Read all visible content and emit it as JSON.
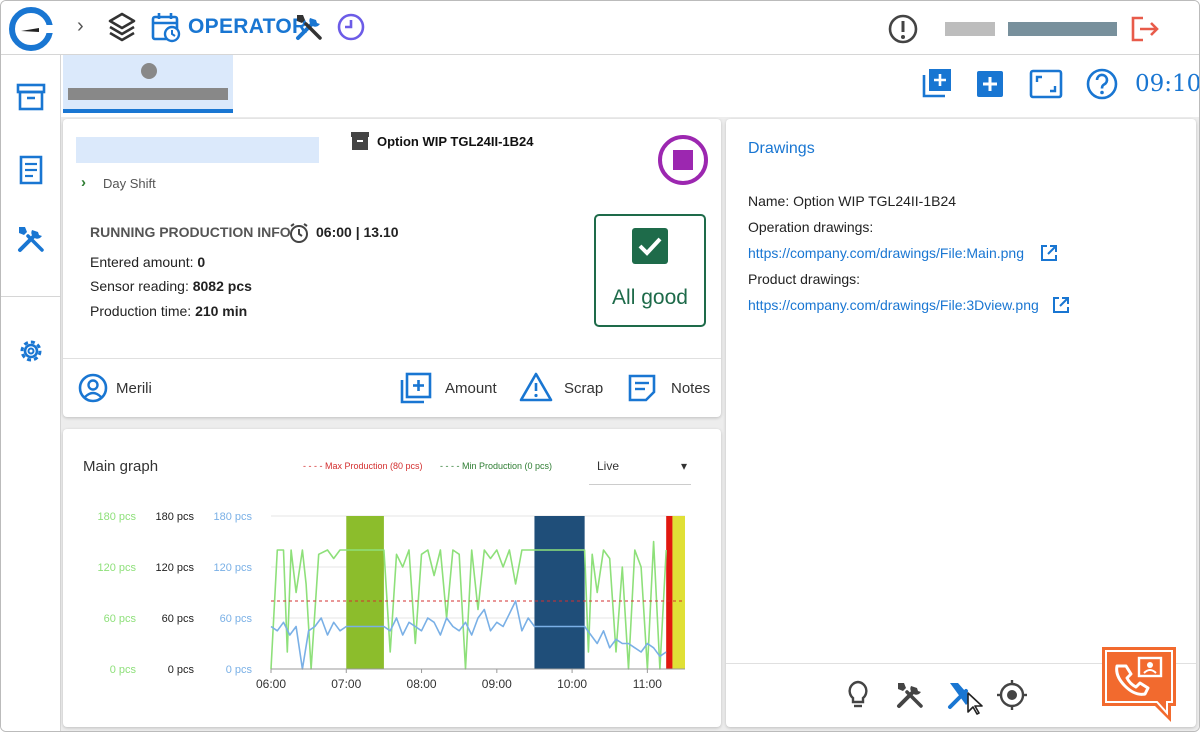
{
  "header": {
    "section_label": "OPERATOR",
    "breadcrumb_separator": "›"
  },
  "tabs": {
    "clock": "09:10"
  },
  "order": {
    "title": "Option WIP TGL24II-1B24",
    "shift": "Day Shift",
    "running_info_title": "RUNNING PRODUCTION INFO",
    "time_range": "06:00 | 13.10",
    "entered_amount_label": "Entered amount:",
    "entered_amount_value": "0",
    "sensor_reading_label": "Sensor reading:",
    "sensor_reading_value": "8082 pcs",
    "production_time_label": "Production time:",
    "production_time_value": "210 min",
    "status_text": "All good",
    "operator_name": "Merili",
    "amount_label": "Amount",
    "scrap_label": "Scrap",
    "notes_label": "Notes"
  },
  "graph": {
    "title": "Main graph",
    "legend_max": "Max Production (80 pcs)",
    "legend_min": "Min Production (0 pcs)",
    "select_value": "Live"
  },
  "chart_data": {
    "type": "line",
    "title": "Main graph",
    "x_ticks": [
      "06:00",
      "07:00",
      "08:00",
      "09:00",
      "10:00",
      "11:00"
    ],
    "xlim": [
      "06:00",
      "11:30"
    ],
    "ylim": [
      0,
      180
    ],
    "y_axes": [
      {
        "ticks": [
          "180 pcs",
          "120 pcs",
          "60 pcs",
          "0 pcs"
        ],
        "color": "#8ee07a"
      },
      {
        "ticks": [
          "180 pcs",
          "120 pcs",
          "60 pcs",
          "0 pcs"
        ],
        "color": "#222222"
      },
      {
        "ticks": [
          "180 pcs",
          "120 pcs",
          "60 pcs",
          "0 pcs"
        ],
        "color": "#7ab0e6"
      }
    ],
    "thresholds": [
      {
        "name": "Max Production (80 pcs)",
        "value": 80,
        "color": "#d32f2f"
      },
      {
        "name": "Min Production (0 pcs)",
        "value": 0,
        "color": "#2e7d32"
      }
    ],
    "bands": [
      {
        "start": "07:00",
        "end": "07:30",
        "color": "#8cbd2c"
      },
      {
        "start": "09:30",
        "end": "10:10",
        "color": "#1f4e79"
      },
      {
        "start": "11:15",
        "end": "11:20",
        "color": "#e1180f"
      },
      {
        "start": "11:20",
        "end": "11:30",
        "color": "#e0e036"
      }
    ],
    "series": [
      {
        "color": "#8ee07a",
        "x": [
          "06:00",
          "06:05",
          "06:10",
          "06:13",
          "06:16",
          "06:20",
          "06:25",
          "06:28",
          "06:32",
          "06:38",
          "06:45",
          "06:50",
          "06:55",
          "07:00",
          "07:30",
          "07:35",
          "07:40",
          "07:45",
          "07:50",
          "07:55",
          "08:00",
          "08:05",
          "08:10",
          "08:15",
          "08:20",
          "08:25",
          "08:30",
          "08:35",
          "08:40",
          "08:45",
          "08:50",
          "08:55",
          "09:00",
          "09:05",
          "09:10",
          "09:15",
          "09:20",
          "09:25",
          "09:30",
          "10:10",
          "10:13",
          "10:16",
          "10:20",
          "10:25",
          "10:30",
          "10:35",
          "10:40",
          "10:45",
          "10:50",
          "10:55",
          "11:00",
          "11:05",
          "11:10",
          "11:15"
        ],
        "y": [
          0,
          140,
          140,
          20,
          140,
          90,
          140,
          100,
          0,
          135,
          140,
          130,
          140,
          140,
          140,
          20,
          135,
          120,
          140,
          30,
          135,
          140,
          110,
          140,
          60,
          140,
          135,
          0,
          140,
          70,
          140,
          130,
          140,
          120,
          140,
          100,
          140,
          140,
          140,
          140,
          20,
          135,
          90,
          140,
          130,
          20,
          120,
          0,
          140,
          120,
          0,
          150,
          0,
          140
        ]
      },
      {
        "color": "#7ab0e6",
        "x": [
          "06:00",
          "06:05",
          "06:10",
          "06:15",
          "06:20",
          "06:25",
          "06:30",
          "06:35",
          "06:40",
          "06:45",
          "06:50",
          "06:55",
          "07:00",
          "07:30",
          "07:35",
          "07:40",
          "07:45",
          "07:50",
          "07:55",
          "08:00",
          "08:05",
          "08:10",
          "08:15",
          "08:20",
          "08:25",
          "08:30",
          "08:35",
          "08:40",
          "08:45",
          "08:50",
          "08:55",
          "09:00",
          "09:05",
          "09:10",
          "09:15",
          "09:20",
          "09:25",
          "09:30",
          "10:10",
          "10:15",
          "10:20",
          "10:25",
          "10:30",
          "10:35",
          "10:40",
          "10:45",
          "10:50",
          "10:55",
          "11:00",
          "11:05",
          "11:10",
          "11:15"
        ],
        "y": [
          50,
          45,
          55,
          40,
          50,
          0,
          45,
          50,
          60,
          40,
          55,
          45,
          50,
          50,
          45,
          60,
          40,
          55,
          50,
          45,
          60,
          55,
          40,
          60,
          50,
          45,
          55,
          40,
          60,
          70,
          45,
          55,
          50,
          65,
          80,
          45,
          60,
          50,
          50,
          40,
          30,
          45,
          25,
          35,
          30,
          30,
          25,
          20,
          30,
          25,
          15,
          20
        ]
      }
    ]
  },
  "drawings": {
    "title": "Drawings",
    "name_line": "Name: Option WIP TGL24II-1B24",
    "operation_label": "Operation drawings:",
    "operation_link": "https://company.com/drawings/File:Main.png",
    "product_label": "Product drawings:",
    "product_link": "https://company.com/drawings/File:3Dview.png"
  }
}
